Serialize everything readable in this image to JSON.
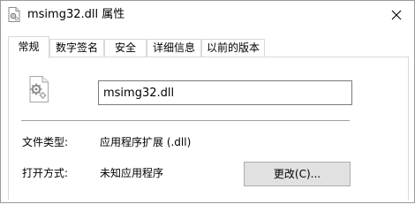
{
  "window": {
    "title": "msimg32.dll 属性",
    "close_glyph": "✕"
  },
  "tabs": [
    {
      "label": "常规",
      "active": true
    },
    {
      "label": "数字签名",
      "active": false
    },
    {
      "label": "安全",
      "active": false
    },
    {
      "label": "详细信息",
      "active": false
    },
    {
      "label": "以前的版本",
      "active": false
    }
  ],
  "general": {
    "file_name": "msimg32.dll",
    "file_type_label": "文件类型:",
    "file_type_value": "应用程序扩展 (.dll)",
    "open_with_label": "打开方式:",
    "open_with_value": "未知应用程序",
    "change_button_label": "更改(C)..."
  },
  "icons": {
    "title": "dll-file-icon",
    "file": "dll-file-gear-icon",
    "close": "close-icon"
  }
}
